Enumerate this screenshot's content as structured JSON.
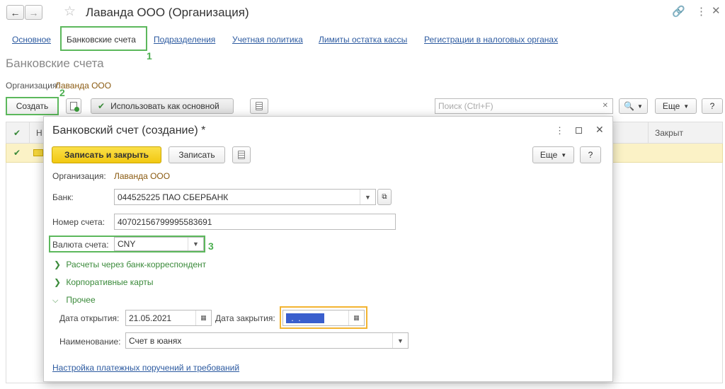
{
  "window": {
    "title": "Лаванда ООО (Организация)"
  },
  "tabs": [
    {
      "label": "Основное"
    },
    {
      "label": "Банковские счета"
    },
    {
      "label": "Подразделения"
    },
    {
      "label": "Учетная политика"
    },
    {
      "label": "Лимиты остатка кассы"
    },
    {
      "label": "Регистрации в налоговых органах"
    }
  ],
  "steps": [
    "1",
    "2",
    "3"
  ],
  "section": {
    "title": "Банковские счета",
    "org_label": "Организация:",
    "org_value": "Лаванда ООО"
  },
  "toolbar": {
    "create": "Создать",
    "use_as_main": "Использовать как основной",
    "search_placeholder": "Поиск (Ctrl+F)",
    "more": "Еще",
    "help": "?"
  },
  "list": {
    "col_n": "Н",
    "col_closed": "Закрыт"
  },
  "dialog": {
    "title": "Банковский счет (создание) *",
    "save_close": "Записать и закрыть",
    "save": "Записать",
    "more": "Еще",
    "help": "?",
    "org_label": "Организация:",
    "org_value": "Лаванда ООО",
    "bank_label": "Банк:",
    "bank_value": "044525225 ПАО СБЕРБАНК",
    "account_label": "Номер счета:",
    "account_value": "40702156799995583691",
    "currency_label": "Валюта счета:",
    "currency_value": "CNY",
    "group_corr": "Расчеты через банк-корреспондент",
    "group_cards": "Корпоративные карты",
    "group_other": "Прочее",
    "open_date_label": "Дата открытия:",
    "open_date_value": "21.05.2021",
    "close_date_label": "Дата закрытия:",
    "close_date_value": " .  .",
    "name_label": "Наименование:",
    "name_value": "Счет в юанях",
    "settings_link": "Настройка платежных поручений и требований"
  },
  "colors": {
    "accent_green": "#5cb85c",
    "save_yellow": "#f7d31b",
    "link_blue": "#2c5aa0",
    "org_brown": "#8a5a10",
    "focus_orange": "#f3b431"
  }
}
